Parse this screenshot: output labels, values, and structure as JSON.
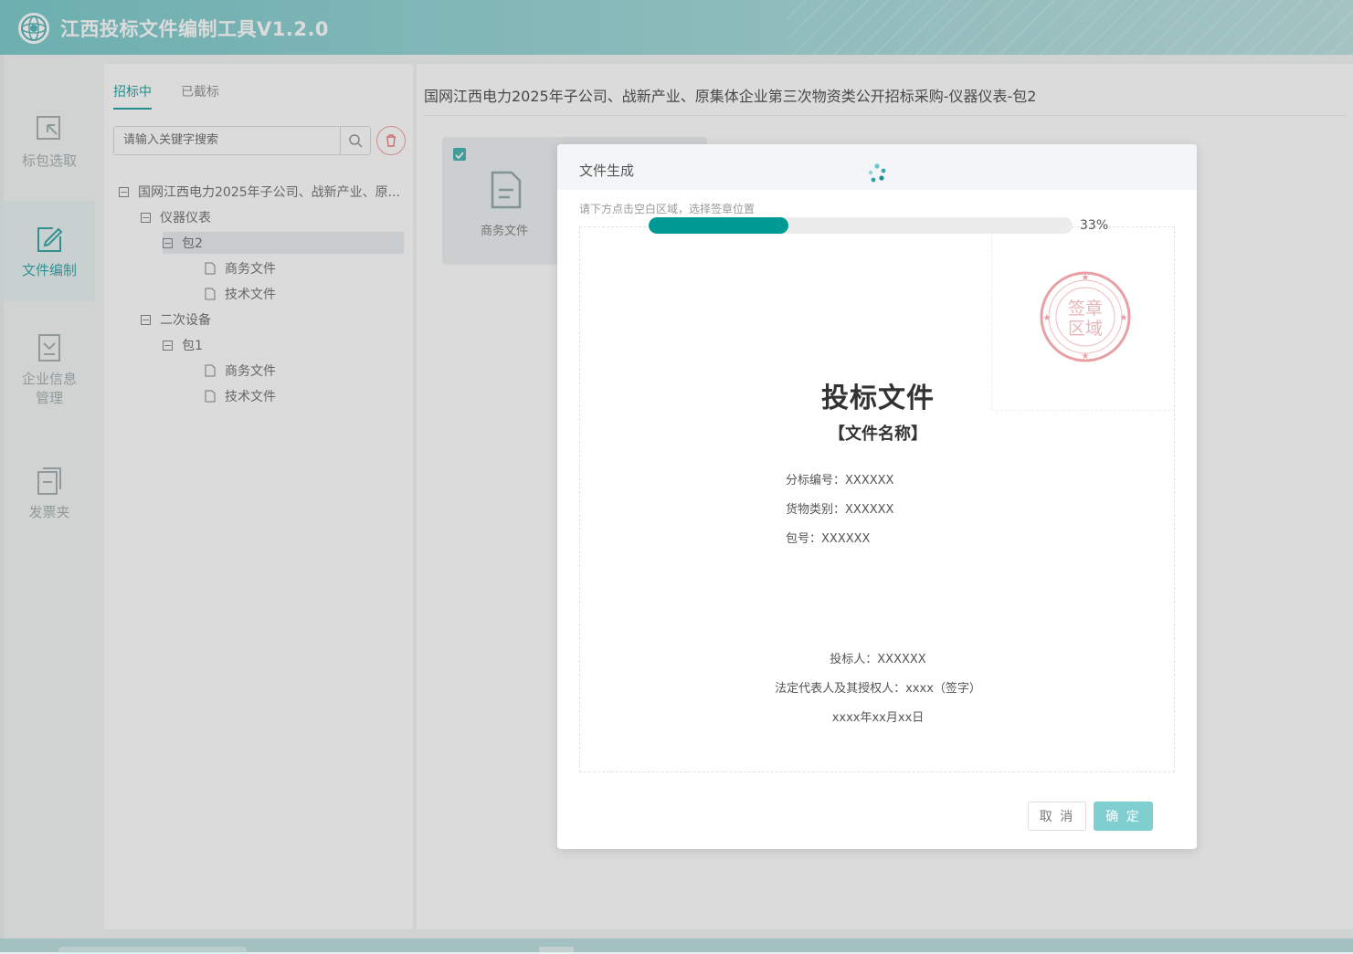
{
  "app": {
    "title": "江西投标文件编制工具V1.2.0"
  },
  "sidebar": {
    "items": [
      {
        "label": "标包选取",
        "icon": "select-package-icon",
        "active": false
      },
      {
        "label": "文件编制",
        "icon": "edit-document-icon",
        "active": true
      },
      {
        "label": "企业信息管理",
        "icon": "company-info-icon",
        "active": false
      },
      {
        "label": "发票夹",
        "icon": "invoice-folder-icon",
        "active": false
      }
    ]
  },
  "tree_panel": {
    "tabs": [
      {
        "label": "招标中",
        "active": true
      },
      {
        "label": "已截标",
        "active": false
      }
    ],
    "search": {
      "placeholder": "请输入关键字搜索",
      "value": ""
    },
    "nodes": [
      {
        "label": "国网江西电力2025年子公司、战新产业、原...",
        "level": 0,
        "type": "folder",
        "expanded": true
      },
      {
        "label": "仪器仪表",
        "level": 1,
        "type": "folder",
        "expanded": true
      },
      {
        "label": "包2",
        "level": 2,
        "type": "folder",
        "expanded": true,
        "selected": true
      },
      {
        "label": "商务文件",
        "level": 3,
        "type": "file"
      },
      {
        "label": "技术文件",
        "level": 3,
        "type": "file"
      },
      {
        "label": "二次设备",
        "level": 1,
        "type": "folder",
        "expanded": true
      },
      {
        "label": "包1",
        "level": 2,
        "type": "folder",
        "expanded": true
      },
      {
        "label": "商务文件",
        "level": 3,
        "type": "file"
      },
      {
        "label": "技术文件",
        "level": 3,
        "type": "file"
      }
    ]
  },
  "content": {
    "title": "国网江西电力2025年子公司、战新产业、原集体企业第三次物资类公开招标采购-仪器仪表-包2",
    "cards": [
      {
        "label": "商务文件",
        "checked": true
      }
    ]
  },
  "modal": {
    "title": "文件生成",
    "hint": "请下方点击空白区域，选择签章位置",
    "progress": {
      "percent": 33,
      "label": "33%"
    },
    "seal": {
      "text_line1": "签章",
      "text_line2": "区域"
    },
    "document": {
      "title": "投标文件",
      "subtitle": "【文件名称】",
      "fields": [
        {
          "label": "分标编号：",
          "value": "XXXXXX"
        },
        {
          "label": "货物类别：",
          "value": "XXXXXX"
        },
        {
          "label": "包号：",
          "value": "XXXXXX"
        }
      ],
      "footer": {
        "bidder": "投标人：XXXXXX",
        "representative": "法定代表人及其授权人：xxxx（签字）",
        "date": "xxxx年xx月xx日"
      }
    },
    "buttons": {
      "cancel": "取 消",
      "ok": "确 定"
    }
  },
  "colors": {
    "accent": "#2aa5a7",
    "progress": "#009a94",
    "seal": "#e8a0a4"
  }
}
